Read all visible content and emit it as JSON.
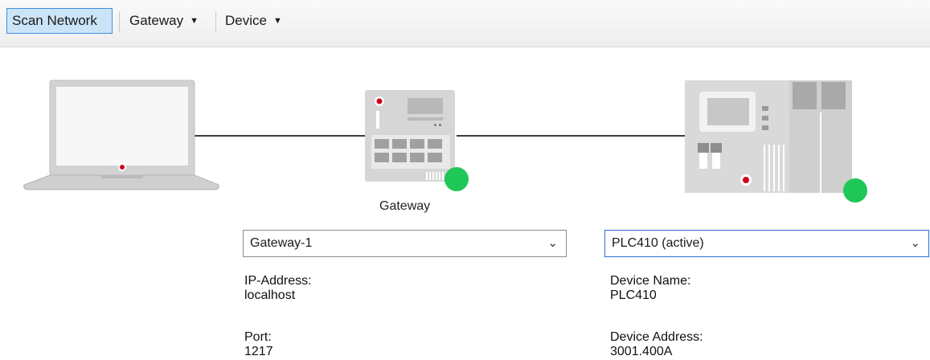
{
  "toolbar": {
    "scan_network": "Scan Network",
    "gateway_menu": "Gateway",
    "device_menu": "Device"
  },
  "colors": {
    "online": "#1fc757",
    "led_red": "#d0021b",
    "device_grey": "#d6d6d6",
    "accent_border": "#2b6fd6"
  },
  "gateway": {
    "label": "Gateway",
    "selected": "Gateway-1",
    "ip_label": "IP-Address:",
    "ip_value": "localhost",
    "port_label": "Port:",
    "port_value": "1217",
    "status": "online"
  },
  "device": {
    "selected": "PLC410 (active)",
    "name_label": "Device Name:",
    "name_value": "PLC410",
    "address_label": "Device Address:",
    "address_value": "3001.400A",
    "status": "online"
  },
  "icons": {
    "dropdown": "chevron-down-icon",
    "menu": "caret-down-icon"
  }
}
